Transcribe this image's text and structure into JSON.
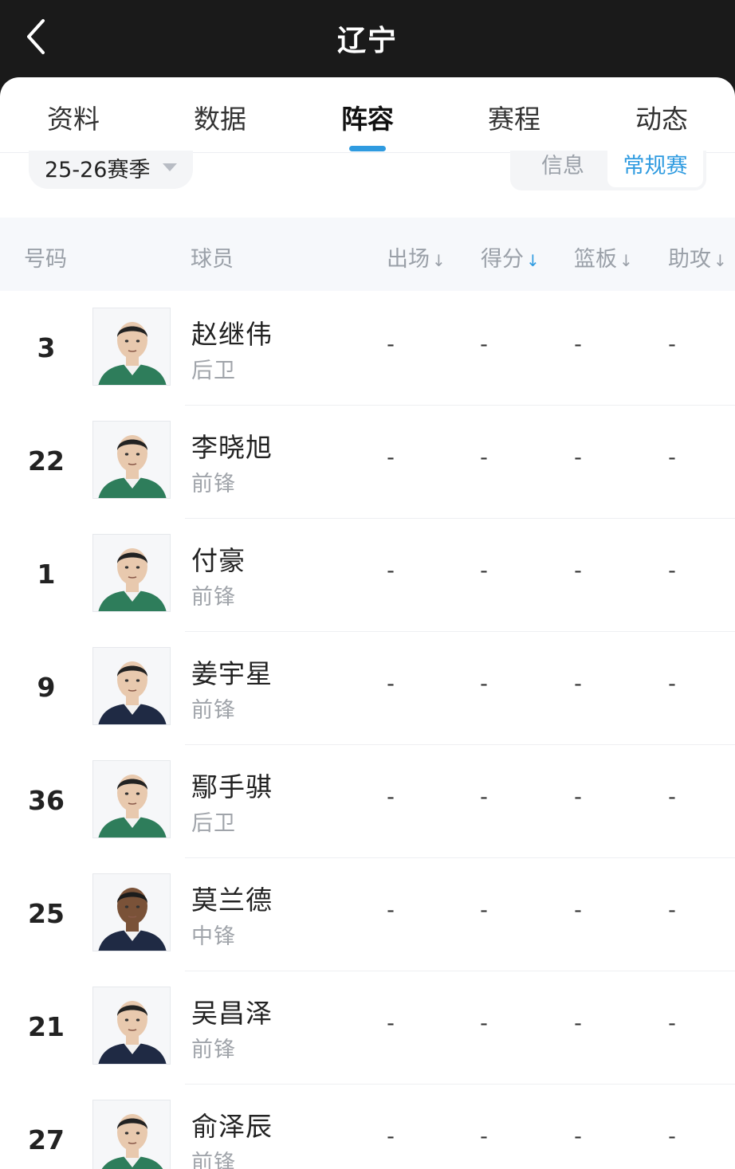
{
  "header": {
    "title": "辽宁"
  },
  "tabs": [
    {
      "label": "资料"
    },
    {
      "label": "数据"
    },
    {
      "label": "阵容"
    },
    {
      "label": "赛程"
    },
    {
      "label": "动态"
    }
  ],
  "active_tab": "阵容",
  "filter": {
    "season": "25-26赛季",
    "segments": [
      "信息",
      "常规赛"
    ],
    "active_segment": "常规赛"
  },
  "table": {
    "headers": {
      "number": "号码",
      "player": "球员",
      "games": "出场",
      "points": "得分",
      "rebounds": "篮板",
      "assists": "助攻"
    },
    "sort_arrow": "↓",
    "active_sort": "得分",
    "accent_color": "#2f9be0",
    "rows": [
      {
        "number": "3",
        "name": "赵继伟",
        "position": "后卫",
        "games": "-",
        "points": "-",
        "rebounds": "-",
        "assists": "-",
        "jersey": "green",
        "skin": "light"
      },
      {
        "number": "22",
        "name": "李晓旭",
        "position": "前锋",
        "games": "-",
        "points": "-",
        "rebounds": "-",
        "assists": "-",
        "jersey": "green",
        "skin": "light"
      },
      {
        "number": "1",
        "name": "付豪",
        "position": "前锋",
        "games": "-",
        "points": "-",
        "rebounds": "-",
        "assists": "-",
        "jersey": "green",
        "skin": "light"
      },
      {
        "number": "9",
        "name": "姜宇星",
        "position": "前锋",
        "games": "-",
        "points": "-",
        "rebounds": "-",
        "assists": "-",
        "jersey": "navy",
        "skin": "light"
      },
      {
        "number": "36",
        "name": "鄢手骐",
        "position": "后卫",
        "games": "-",
        "points": "-",
        "rebounds": "-",
        "assists": "-",
        "jersey": "green",
        "skin": "light"
      },
      {
        "number": "25",
        "name": "莫兰德",
        "position": "中锋",
        "games": "-",
        "points": "-",
        "rebounds": "-",
        "assists": "-",
        "jersey": "navy",
        "skin": "dark"
      },
      {
        "number": "21",
        "name": "吴昌泽",
        "position": "前锋",
        "games": "-",
        "points": "-",
        "rebounds": "-",
        "assists": "-",
        "jersey": "navy",
        "skin": "light"
      },
      {
        "number": "27",
        "name": "俞泽辰",
        "position": "前锋",
        "games": "-",
        "points": "-",
        "rebounds": "-",
        "assists": "-",
        "jersey": "green",
        "skin": "light"
      }
    ]
  }
}
